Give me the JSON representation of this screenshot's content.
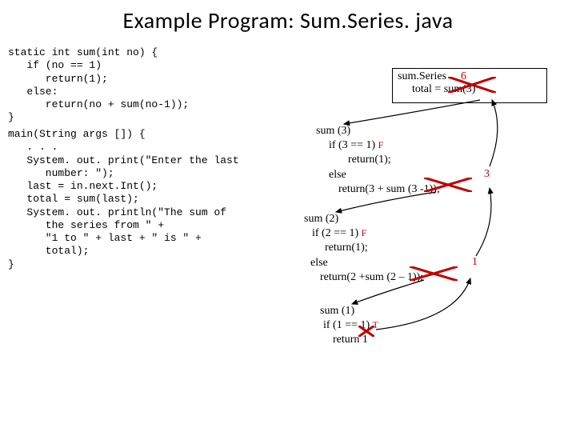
{
  "title": "Example Program: Sum.Series. java",
  "code": {
    "sum": "static int sum(int no) {\n   if (no == 1)\n      return(1);\n   else:\n      return(no + sum(no-1));\n}",
    "main": "main(String args []) {\n   . . .\n   System. out. print(\"Enter the last\n      number: \");\n   last = in.next.Int();\n   total = sum(last);\n   System. out. println(\"The sum of\n      the series from \" +\n      \"1 to \" + last + \" is \" +\n      total);\n}"
  },
  "box": {
    "label": "sum.Series",
    "expr": "total = sum(3)",
    "result": "6"
  },
  "trace3": {
    "call": "sum (3)",
    "cond": "if (3 == 1)",
    "tf": "F",
    "ret1": "return(1);",
    "else": "else",
    "ret": "return(3 + sum (3 -1));",
    "val": "3"
  },
  "trace2": {
    "call": "sum (2)",
    "cond": "if (2 == 1)",
    "tf": "F",
    "ret1": "return(1);",
    "else": "else",
    "ret": "return(2 +sum (2 – 1));",
    "val": "1"
  },
  "trace1": {
    "call": "sum (1)",
    "cond": "if (1 == 1)",
    "tf": "T",
    "ret": "return 1"
  }
}
